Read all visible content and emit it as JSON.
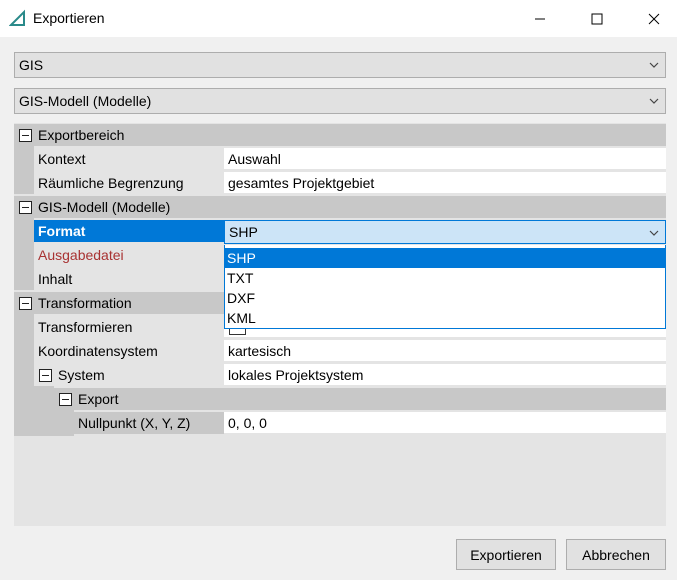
{
  "window": {
    "title": "Exportieren"
  },
  "combos": {
    "format_group": "GIS",
    "model": "GIS-Modell (Modelle)"
  },
  "grid": {
    "cat_export_area": "Exportbereich",
    "kontext_name": "Kontext",
    "kontext_value": "Auswahl",
    "raum_name": "Räumliche Begrenzung",
    "raum_value": "gesamtes Projektgebiet",
    "cat_gis_model": "GIS-Modell (Modelle)",
    "format_name": "Format",
    "format_value": "SHP",
    "ausgabe_name": "Ausgabedatei",
    "inhalt_name": "Inhalt",
    "cat_transformation": "Transformation",
    "transform_name": "Transformieren",
    "koord_name": "Koordinatensystem",
    "koord_value": "kartesisch",
    "system_name": "System",
    "system_value": "lokales Projektsystem",
    "export_name": "Export",
    "nullpunkt_name": "Nullpunkt (X, Y, Z)",
    "nullpunkt_value": "0, 0, 0"
  },
  "format_options": [
    "SHP",
    "TXT",
    "DXF",
    "KML"
  ],
  "buttons": {
    "export": "Exportieren",
    "cancel": "Abbrechen"
  },
  "colors": {
    "accent": "#0078d7",
    "selection_bg": "#cce4f7",
    "category_bg": "#c8c8c8",
    "error_text": "#a83232"
  }
}
